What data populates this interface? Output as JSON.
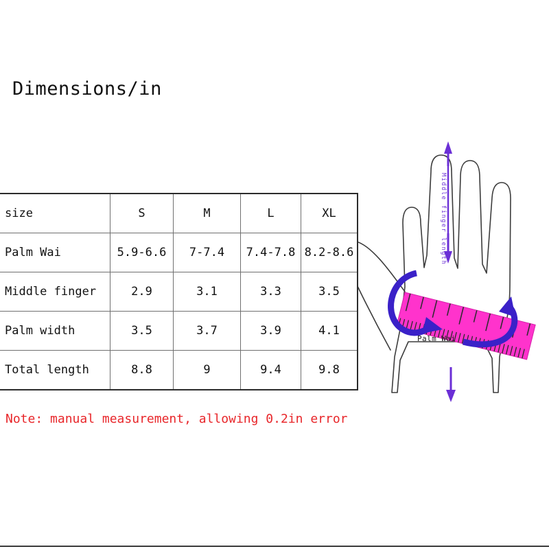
{
  "title": "Dimensions/in",
  "note": "Note: manual measurement, allowing 0.2in error",
  "table": {
    "columns": [
      "size",
      "S",
      "M",
      "L",
      "XL"
    ],
    "rows": [
      {
        "label": "Palm Wai",
        "values": [
          "5.9-6.6",
          "7-7.4",
          "7.4-7.8",
          "8.2-8.6"
        ]
      },
      {
        "label": "Middle finger",
        "values": [
          "2.9",
          "3.1",
          "3.3",
          "3.5"
        ]
      },
      {
        "label": "Palm width",
        "values": [
          "3.5",
          "3.7",
          "3.9",
          "4.1"
        ]
      },
      {
        "label": "Total length",
        "values": [
          "8.8",
          "9",
          "9.4",
          "9.8"
        ]
      }
    ]
  },
  "diagram": {
    "middle_finger_label": "Middle finger length",
    "palm_wai_label": "Palm Wai",
    "icons": {
      "hand": "hand-outline-icon",
      "ruler": "ruler-icon",
      "wrap_arrow": "curved-wrap-arrow-icon",
      "up_arrow": "arrow-up-icon",
      "down_arrow": "arrow-down-icon",
      "length_arrow": "arrow-down-length-icon"
    }
  },
  "colors": {
    "ruler_pink": "#FF33CC",
    "arrow_blue": "#3A21C8",
    "measure_purple": "#6B2FD6",
    "note_red": "#E8262A",
    "table_border": "#6F6F6F",
    "table_frame": "#2B2B2B",
    "hand_outline": "#3C3C3C",
    "text": "#111111"
  }
}
